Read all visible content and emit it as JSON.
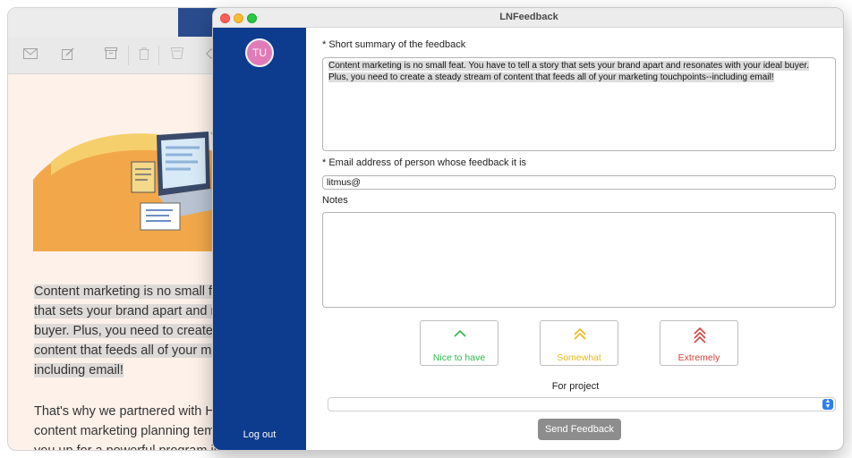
{
  "window": {
    "title": "LNFeedback"
  },
  "user": {
    "initials": "TU"
  },
  "sidebar": {
    "logout_label": "Log out"
  },
  "form": {
    "summary_label": "* Short summary of the feedback",
    "summary_value": "Content marketing is no small feat. You have to tell a story that sets your brand apart and resonates with your ideal buyer. Plus, you need to create a steady stream of content that feeds all of your marketing touchpoints--including email!",
    "email_label": "* Email address of person whose feedback it is",
    "email_value": "litmus@",
    "notes_label": "Notes",
    "notes_value": "",
    "priorities": [
      {
        "label": "Nice to have",
        "icon": "single-chevron-up-icon",
        "color": "#2db84d"
      },
      {
        "label": "Somewhat",
        "icon": "double-chevron-up-icon",
        "color": "#e6b91e"
      },
      {
        "label": "Extremely",
        "icon": "triple-chevron-up-icon",
        "color": "#d2443c"
      }
    ],
    "project_label": "For project",
    "project_value": "",
    "send_label": "Send Feedback"
  },
  "background_mail": {
    "paragraph1_lines": [
      "Content marketing is no small fe",
      "that sets your brand apart and re",
      "buyer. Plus, you need to create a",
      "content that feeds all of your ma",
      "including email!"
    ],
    "paragraph2_lines": [
      "That's why we partnered with Hu",
      "content marketing planning temp",
      "you up for a powerful program in"
    ]
  }
}
